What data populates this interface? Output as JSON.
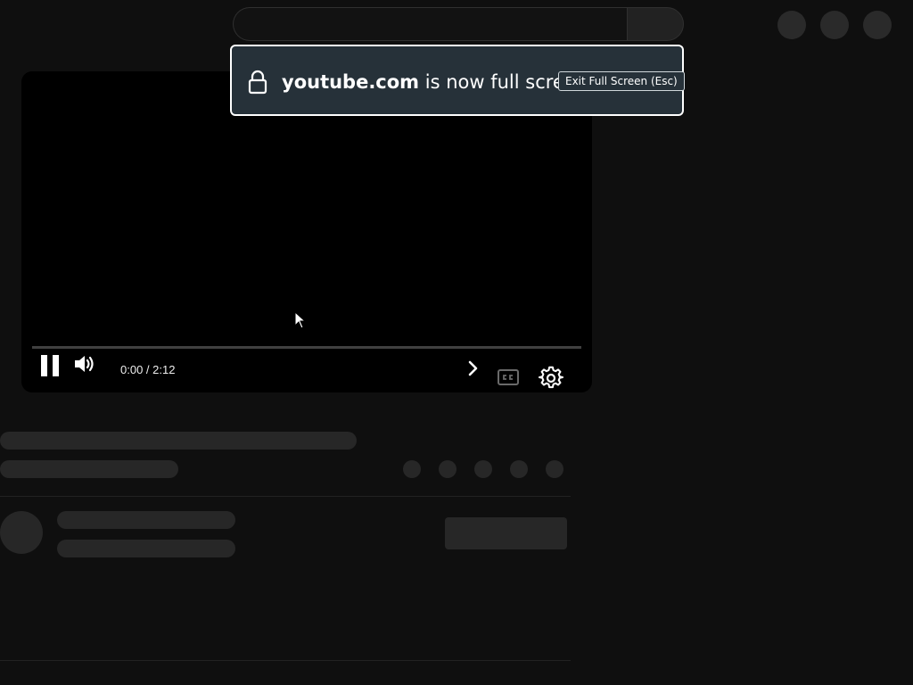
{
  "fullscreen_notice": {
    "domain": "youtube.com",
    "message": "is now full screen",
    "exit_label": "Exit Full Screen (Esc)"
  },
  "player": {
    "time_display": "0:00 / 2:12",
    "progress_fraction": 0.0,
    "state": "playing"
  },
  "icons": {
    "lock": "lock-icon",
    "pause": "pause-icon",
    "volume": "volume-icon",
    "next": "chevron-right-icon",
    "captions": "closed-captions-icon",
    "settings": "gear-icon"
  },
  "colors": {
    "page_background": "#0f0f0f",
    "banner_background": "#263139",
    "placeholder": "#272727",
    "progress": "#ff0000"
  }
}
